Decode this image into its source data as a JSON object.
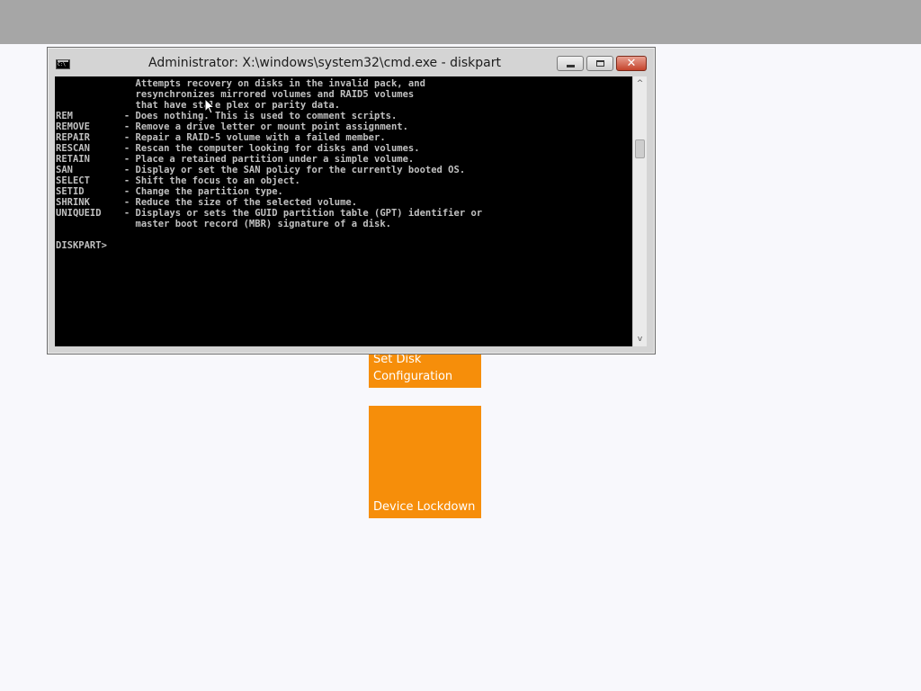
{
  "window": {
    "title": "Administrator: X:\\windows\\system32\\cmd.exe - diskpart",
    "close_glyph": "✕"
  },
  "console": {
    "lines": [
      "              Attempts recovery on disks in the invalid pack, and",
      "              resynchronizes mirrored volumes and RAID5 volumes",
      "              that have stale plex or parity data.",
      "REM         - Does nothing. This is used to comment scripts.",
      "REMOVE      - Remove a drive letter or mount point assignment.",
      "REPAIR      - Repair a RAID-5 volume with a failed member.",
      "RESCAN      - Rescan the computer looking for disks and volumes.",
      "RETAIN      - Place a retained partition under a simple volume.",
      "SAN         - Display or set the SAN policy for the currently booted OS.",
      "SELECT      - Shift the focus to an object.",
      "SETID       - Change the partition type.",
      "SHRINK      - Reduce the size of the selected volume.",
      "UNIQUEID    - Displays or sets the GUID partition table (GPT) identifier or",
      "              master boot record (MBR) signature of a disk.",
      "",
      "DISKPART>"
    ]
  },
  "scrollbar": {
    "up_glyph": "^",
    "down_glyph": "v"
  },
  "tiles": {
    "disk_config": [
      "Set Disk",
      "Configuration"
    ],
    "device_lockdown": "Device Lockdown"
  },
  "colors": {
    "tile": "#f68e0a",
    "console_bg": "#000000",
    "console_text": "#c0c0c0",
    "top_bar": "#a6a6a6"
  }
}
